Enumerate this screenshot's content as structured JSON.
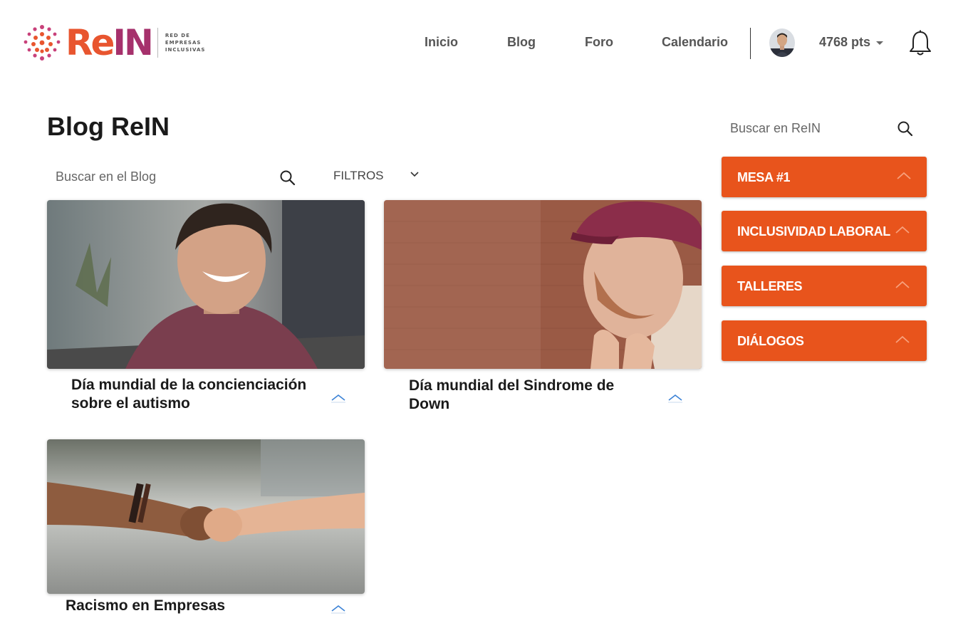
{
  "header": {
    "logo": {
      "word_re": "Re",
      "word_in": "IN",
      "tagline": [
        "RED DE",
        "EMPRESAS",
        "INCLUSIVAS"
      ]
    },
    "nav": [
      {
        "label": "Inicio"
      },
      {
        "label": "Blog"
      },
      {
        "label": "Foro"
      },
      {
        "label": "Calendario"
      }
    ],
    "points": "4768 pts"
  },
  "page": {
    "title": "Blog ReIN",
    "search_placeholder": "Buscar en el Blog",
    "filters_label": "FILTROS"
  },
  "posts": [
    {
      "title": "Día mundial de la concienciación sobre el autismo"
    },
    {
      "title": "Día mundial del Sindrome de Down"
    },
    {
      "title": "Racismo en Empresas"
    }
  ],
  "sidebar": {
    "search_placeholder": "Buscar en ReIN",
    "categories": [
      {
        "label": "MESA #1"
      },
      {
        "label": "INCLUSIVIDAD LABORAL"
      },
      {
        "label": "TALLERES"
      },
      {
        "label": "DIÁLOGOS"
      }
    ]
  },
  "colors": {
    "brand_orange": "#e8552f",
    "brand_plum": "#a6316c",
    "category_button": "#e8541c",
    "toggle_chevron": "#3b82d6"
  },
  "icons": [
    "rein-logo-dots",
    "search-icon",
    "chevron-down-icon",
    "chevron-up-icon",
    "bell-icon",
    "caret-down-icon",
    "avatar"
  ]
}
